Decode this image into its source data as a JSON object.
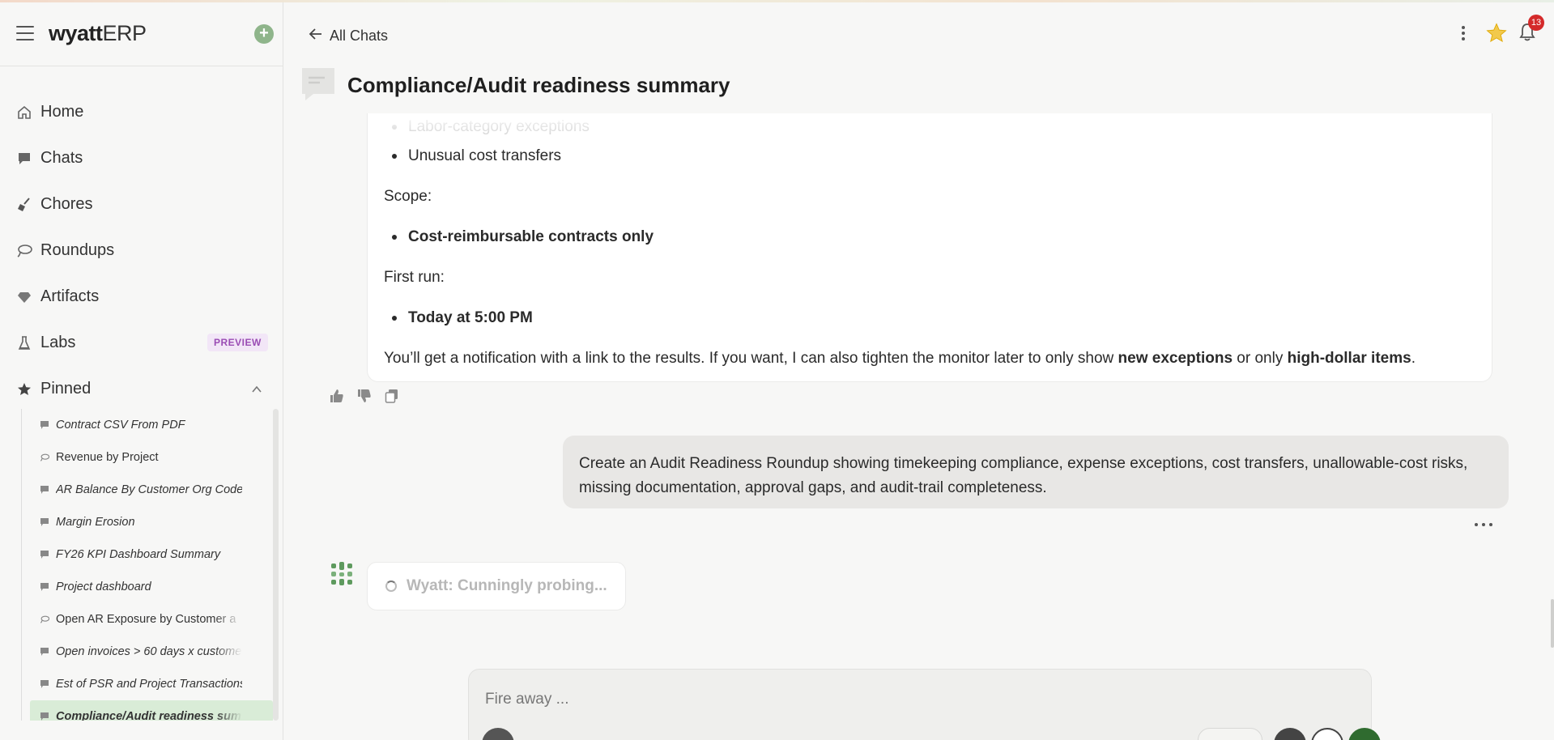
{
  "app": {
    "brand_bold": "wyatt",
    "brand_light": "ERP"
  },
  "sidebar": {
    "nav": [
      {
        "label": "Home",
        "icon": "home-icon"
      },
      {
        "label": "Chats",
        "icon": "chat-icon"
      },
      {
        "label": "Chores",
        "icon": "broom-icon"
      },
      {
        "label": "Roundups",
        "icon": "lasso-icon"
      },
      {
        "label": "Artifacts",
        "icon": "gem-icon"
      },
      {
        "label": "Labs",
        "icon": "flask-icon",
        "badge": "PREVIEW"
      },
      {
        "label": "Pinned",
        "icon": "star-icon"
      }
    ],
    "pinned": [
      {
        "label": "Contract CSV From PDF",
        "icon": "chat-icon"
      },
      {
        "label": "Revenue by Project",
        "icon": "lasso-icon"
      },
      {
        "label": "AR Balance By Customer Org Code",
        "icon": "chat-icon"
      },
      {
        "label": "Margin Erosion",
        "icon": "chat-icon"
      },
      {
        "label": "FY26 KPI Dashboard Summary",
        "icon": "chat-icon"
      },
      {
        "label": "Project dashboard",
        "icon": "chat-icon"
      },
      {
        "label": "Open AR Exposure by Customer a",
        "icon": "lasso-icon"
      },
      {
        "label": "Open invoices > 60 days x custome",
        "icon": "chat-icon"
      },
      {
        "label": "Est of PSR and Project Transactions",
        "icon": "chat-icon"
      },
      {
        "label": "Compliance/Audit readiness sum",
        "icon": "chat-icon"
      }
    ]
  },
  "header": {
    "back_label": "All Chats",
    "notification_count": "13",
    "title": "Compliance/Audit readiness summary"
  },
  "assistant_message": {
    "faded_bullet": "Labor-category exceptions",
    "bullet_1": "Unusual cost transfers",
    "scope_label": "Scope:",
    "scope_value": "Cost-reimbursable contracts only",
    "first_run_label": "First run:",
    "first_run_value": "Today at 5:00 PM",
    "closing_1": "You’ll get a notification with a link to the results. If you want, I can also tighten the monitor later to only show ",
    "closing_bold_1": "new exceptions",
    "closing_2": " or only ",
    "closing_bold_2": "high-dollar items",
    "closing_3": "."
  },
  "user_message": {
    "text": "Create an Audit Readiness Roundup showing timekeeping compliance, expense exceptions, cost transfers, unallowable-cost risks, missing documentation, approval gaps, and audit-trail completeness."
  },
  "thinking": {
    "label": "Wyatt: Cunningly probing..."
  },
  "composer": {
    "placeholder": "Fire away ..."
  },
  "colors": {
    "accent_green": "#8fb58b",
    "active_pinned_bg": "#d9ecd7",
    "badge_red": "#d42a2a",
    "preview_purple": "#9a4cb4"
  }
}
